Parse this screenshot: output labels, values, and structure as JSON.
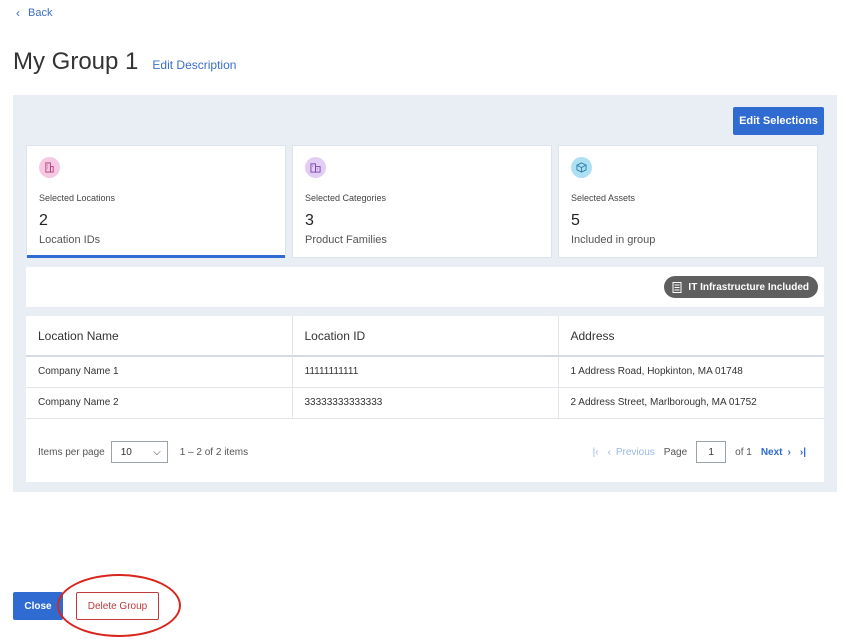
{
  "nav": {
    "back_label": "Back"
  },
  "header": {
    "title": "My Group 1",
    "edit_description": "Edit Description"
  },
  "toolbar": {
    "edit_selections": "Edit Selections"
  },
  "cards": [
    {
      "label": "Selected Locations",
      "value": "2",
      "sub": "Location IDs",
      "icon": "building-icon",
      "color": "#f6c9e3"
    },
    {
      "label": "Selected Categories",
      "value": "3",
      "sub": "Product Families",
      "icon": "buildings-icon",
      "color": "#e2cdf3"
    },
    {
      "label": "Selected Assets",
      "value": "5",
      "sub": "Included in group",
      "icon": "cube-icon",
      "color": "#aee0f4"
    }
  ],
  "badge": {
    "label": "IT Infrastructure Included",
    "icon": "server-icon"
  },
  "table": {
    "columns": [
      "Location Name",
      "Location ID",
      "Address"
    ],
    "rows": [
      [
        "Company Name 1",
        "11111111111",
        "1 Address Road, Hopkinton, MA 01748"
      ],
      [
        "Company Name 2",
        "33333333333333",
        "2 Address Street, Marlborough, MA 01752"
      ]
    ]
  },
  "pager": {
    "items_per_page_label": "Items per page",
    "page_size": "10",
    "range": "1 – 2 of 2 items",
    "previous": "Previous",
    "page_label": "Page",
    "page_value": "1",
    "of_label": "of 1",
    "next": "Next"
  },
  "footer": {
    "close": "Close",
    "delete_group": "Delete Group"
  },
  "colors": {
    "accent": "#2f6bd0",
    "danger": "#c0393b",
    "highlight": "#d9261c",
    "panel_bg": "#e9eef4"
  }
}
